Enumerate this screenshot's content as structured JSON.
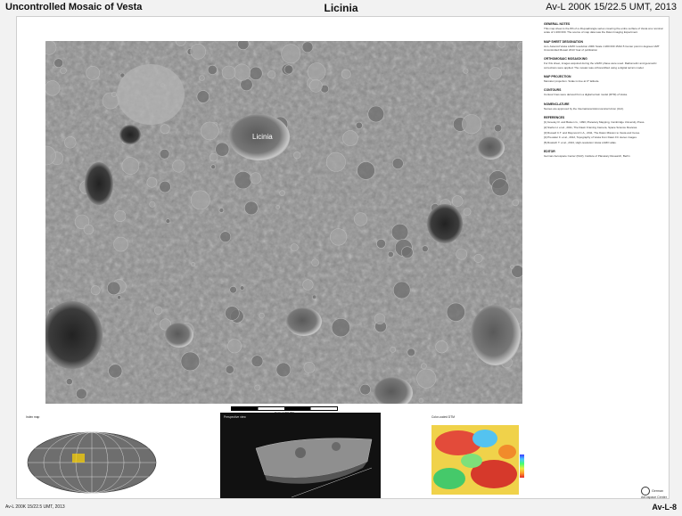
{
  "header": {
    "left_title": "Uncontrolled Mosaic of Vesta",
    "center_title": "Licinia",
    "right_title": "Av-L 200K 15/22.5 UMT, 2013"
  },
  "map": {
    "feature_label": "Licinia",
    "scale_label": "Scale 1:200 000"
  },
  "panel": {
    "sections": [
      {
        "heading": "GENERAL NOTES",
        "text": "This map sheet is the 8th of a 29-quadrangle series covering the entire surface of Vesta at a nominal scale of 1:200 000. The source of map data was the Dawn Imaging Experiment."
      },
      {
        "heading": "MAP SHEET DESIGNATION",
        "text": "Av-L  Asteroid Vesta  LAMO resolution  200K  Scale 1:200 000  15/22.5  Center point in degrees  UMT  Uncontrolled Mosaic  2013  Year of publication"
      },
      {
        "heading": "ORTHOMOSAIC MOSAICKING",
        "text": "For this sheet, images acquired during the LAMO phase were used. Radiometric and geometric corrections were applied. The mosaic was orthorectified using a digital terrain model."
      },
      {
        "heading": "MAP PROJECTION",
        "text": "Mercator projection. Scale is true at 0° latitude."
      },
      {
        "heading": "CONTOURS",
        "text": "Contour lines were derived from a digital terrain model (DTM) of Vesta."
      },
      {
        "heading": "NOMENCLATURE",
        "text": "Names are approved by the International Astronomical Union (IAU)."
      },
      {
        "heading": "REFERENCES",
        "text": ""
      },
      {
        "heading": "EDITOR",
        "text": "German Aerospace Center (DLR), Institute of Planetary Research, Berlin"
      }
    ],
    "references": [
      "[1] Greeley R. and Batson G., 1990, Planetary Mapping, Cambridge University Press.",
      "[2] Sierks H. et al., 2011, The Dawn Framing Camera, Space Science Reviews.",
      "[3] Russell C.T. and Raymond C.A., 2011, The Dawn Mission to Vesta and Ceres.",
      "[4] Preusker F. et al., 2012, Topography of Vesta from Dawn FC stereo images.",
      "[5] Roatsch T. et al., 2013, High-resolution Vesta LAMO atlas."
    ]
  },
  "insets": {
    "index_caption": "Index map",
    "perspective_caption": "Perspective view",
    "color_caption": "Color-coded DTM"
  },
  "footer": {
    "left": "Av-L 200K 15/22.5 UMT, 2013",
    "right": "Av-L-8",
    "agency": "German Aerospace Center"
  }
}
